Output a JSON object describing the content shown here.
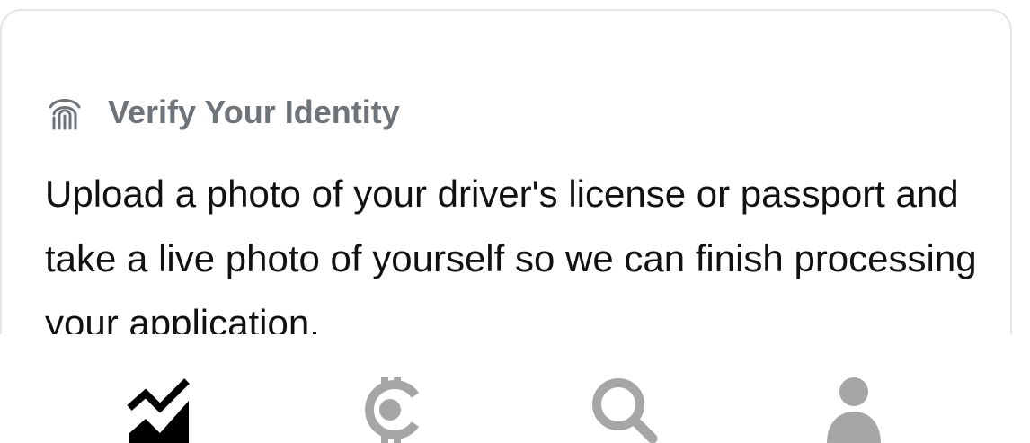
{
  "card": {
    "icon": "fingerprint-icon",
    "title": "Verify Your Identity",
    "body": "Upload a photo of your driver's license or passport and take a live photo of yourself so we can finish processing your application."
  },
  "nav": {
    "items": [
      {
        "icon": "chart-icon",
        "active": true
      },
      {
        "icon": "crypto-icon",
        "active": false
      },
      {
        "icon": "search-icon",
        "active": false
      },
      {
        "icon": "account-icon",
        "active": false
      }
    ],
    "active_color": "#000000",
    "inactive_color": "#a6a6a6"
  },
  "colors": {
    "title_gray": "#6f7479",
    "body_text": "#111111",
    "card_border": "#e3e5e8"
  }
}
